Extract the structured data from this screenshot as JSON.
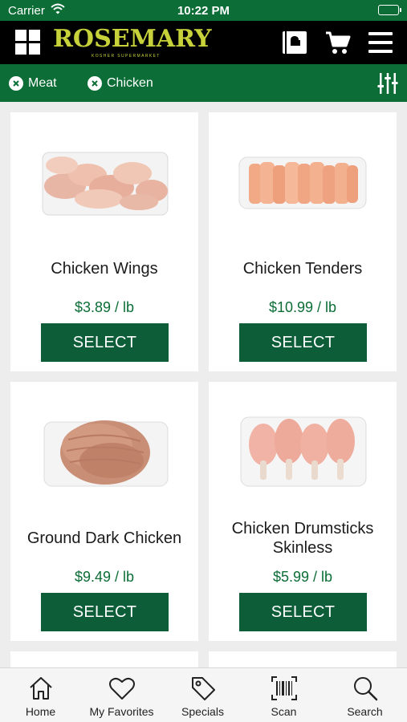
{
  "status_bar": {
    "carrier": "Carrier",
    "time": "10:22 PM"
  },
  "header": {
    "logo_name": "ROSEMARY",
    "logo_tagline": "KOSHER SUPERMARKET",
    "icons": [
      "grid-menu-icon",
      "store-book-icon",
      "cart-icon",
      "hamburger-icon"
    ]
  },
  "filters": {
    "chips": [
      {
        "label": "Meat"
      },
      {
        "label": "Chicken"
      }
    ]
  },
  "products": [
    {
      "name": "Chicken Wings",
      "price": "$3.89 / lb",
      "button": "SELECT",
      "image": "chicken-wings-tray"
    },
    {
      "name": "Chicken Tenders",
      "price": "$10.99 / lb",
      "button": "SELECT",
      "image": "chicken-tenders-tray"
    },
    {
      "name": "Ground Dark Chicken",
      "price": "$9.49 / lb",
      "button": "SELECT",
      "image": "ground-chicken-tray"
    },
    {
      "name": "Chicken Drumsticks Skinless",
      "price": "$5.99 / lb",
      "button": "SELECT",
      "image": "drumsticks-tray"
    }
  ],
  "tabs": [
    {
      "label": "Home",
      "icon": "home-icon"
    },
    {
      "label": "My Favorites",
      "icon": "heart-icon"
    },
    {
      "label": "Specials",
      "icon": "tag-icon"
    },
    {
      "label": "Scan",
      "icon": "barcode-icon"
    },
    {
      "label": "Search",
      "icon": "search-icon"
    }
  ],
  "colors": {
    "brand_green": "#0c6d36",
    "button_green": "#0c5d38",
    "logo_yellow": "#c7d23a",
    "header_black": "#000000"
  }
}
